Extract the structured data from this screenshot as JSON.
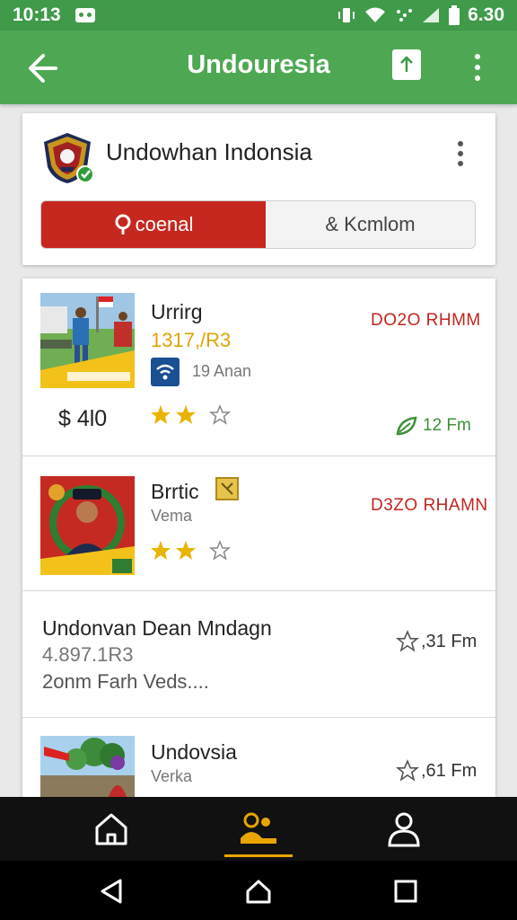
{
  "status_bar": {
    "time": "10:13",
    "battery": "6.30"
  },
  "app_bar": {
    "title": "Undouresia"
  },
  "profile": {
    "name": "Undowhan Indonsia",
    "tabs": [
      {
        "label": "coenal",
        "active": true
      },
      {
        "label": "& Kcmlom",
        "active": false
      }
    ]
  },
  "listings": [
    {
      "title": "Urrirg",
      "price_label": "1317,/R3",
      "meta": "19 Anan",
      "price": "$ 4l0",
      "tag": "DO2O RHMM",
      "rating": 2,
      "distance": "12 Fm"
    },
    {
      "title": "Brrtic",
      "subtitle": "Vema",
      "tag": "D3ZO RHAMN",
      "rating": 2
    },
    {
      "title": "Undonvan Dean Mndagn",
      "line2": "4.897.1R3",
      "line3": "2onm Farh Veds....",
      "rate": ",31 Fm"
    },
    {
      "title": "Undovsia",
      "subtitle": "Verka",
      "rate": ",61 Fm"
    }
  ],
  "colors": {
    "app_bar": "#4ea853",
    "accent_red": "#c6281f",
    "star": "#e8b400",
    "nav_active": "#e8a500"
  },
  "bottom_nav": {
    "active": "community-icon"
  }
}
